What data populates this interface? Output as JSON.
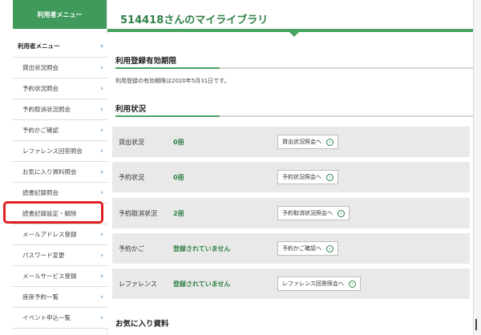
{
  "sidebar": {
    "header": "利用者メニュー",
    "chevron": "›",
    "items": [
      {
        "label": "利用者メニュー"
      },
      {
        "label": "貸出状況照会"
      },
      {
        "label": "予約状況照会"
      },
      {
        "label": "予約取消状況照会"
      },
      {
        "label": "予約かご確認"
      },
      {
        "label": "レファレンス回答照会"
      },
      {
        "label": "お気に入り資料照会"
      },
      {
        "label": "読書記録照会"
      },
      {
        "label": "読書記録設定・解除"
      },
      {
        "label": "メールアドレス登録"
      },
      {
        "label": "パスワード変更"
      },
      {
        "label": "メールサービス登録"
      },
      {
        "label": "座席予約一覧"
      },
      {
        "label": "イベント申込一覧"
      }
    ]
  },
  "main": {
    "title": "514418さんのマイライブラリ",
    "section1": {
      "title": "利用登録有効期限",
      "desc": "利用登録の有効期限は2020年5月31日です。"
    },
    "section2": {
      "title": "利用状況",
      "rows": [
        {
          "label": "貸出状況",
          "value": "0冊",
          "button": "貸出状況照会へ"
        },
        {
          "label": "予約状況",
          "value": "0冊",
          "button": "予約状況照会へ"
        },
        {
          "label": "予約取消状況",
          "value": "2冊",
          "button": "予約取消状況照会へ"
        },
        {
          "label": "予約かご",
          "value": "登録されていません",
          "button": "予約かご確認へ"
        },
        {
          "label": "レファレンス",
          "value": "登録されていません",
          "button": "レファレンス回答照会へ"
        }
      ]
    },
    "section3": {
      "title": "お気に入り資料"
    },
    "button_icon": "›"
  },
  "colors": {
    "accent": "#3f9a5c",
    "highlight": "#e02020"
  }
}
